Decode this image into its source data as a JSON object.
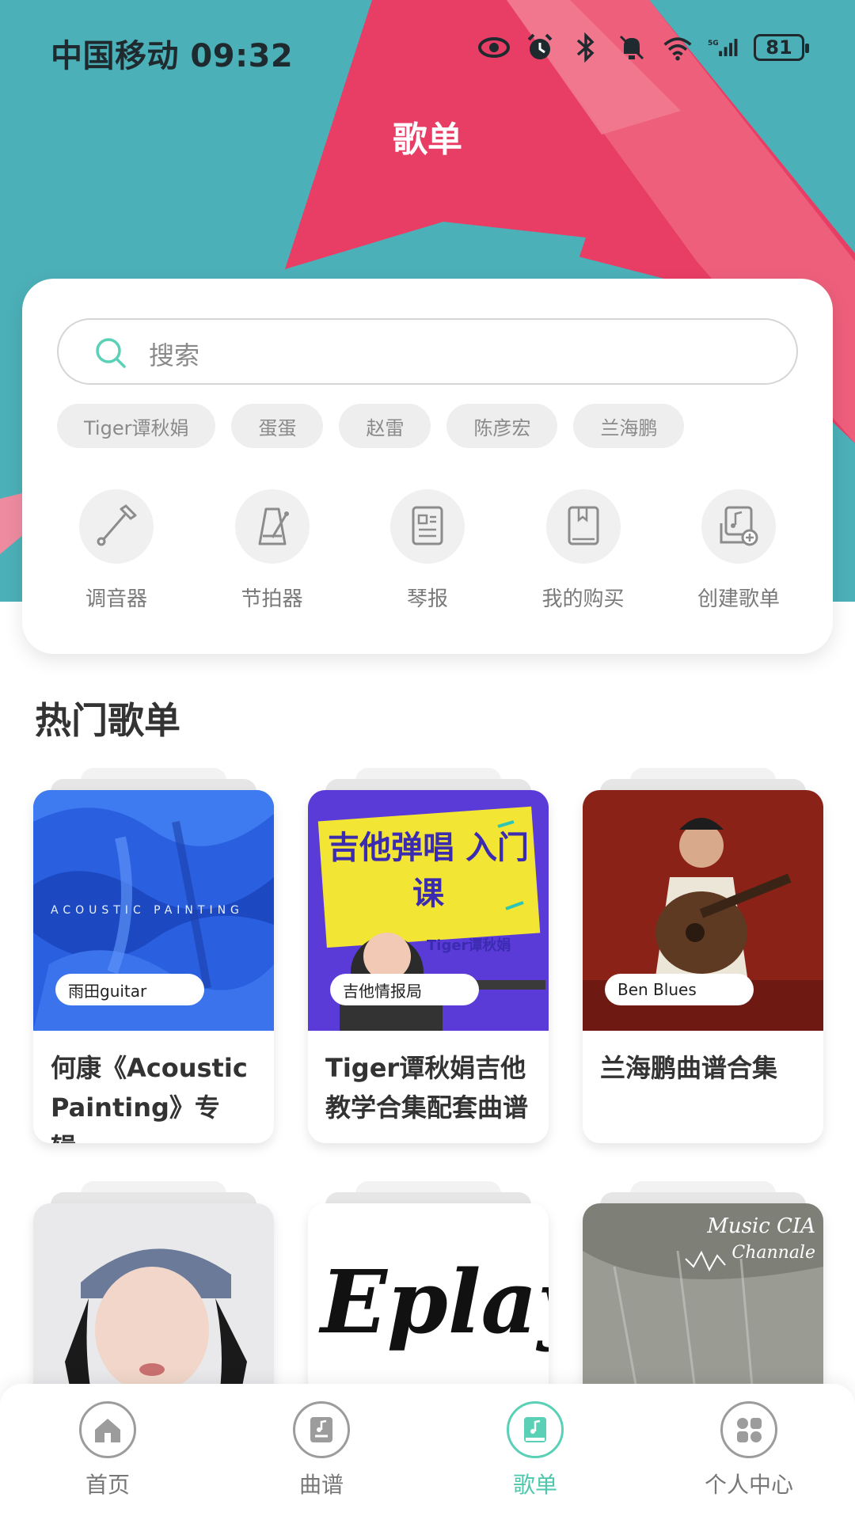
{
  "status_bar": {
    "carrier_time": "中国移动 09:32",
    "battery": "81"
  },
  "page_title": "歌单",
  "search": {
    "placeholder": "搜索"
  },
  "hot_tags": [
    "Tiger谭秋娟",
    "蛋蛋",
    "赵雷",
    "陈彦宏",
    "兰海鹏"
  ],
  "tools": [
    {
      "label": "调音器",
      "icon": "tuning-fork-icon"
    },
    {
      "label": "节拍器",
      "icon": "metronome-icon"
    },
    {
      "label": "琴报",
      "icon": "newspaper-icon"
    },
    {
      "label": "我的购买",
      "icon": "book-icon"
    },
    {
      "label": "创建歌单",
      "icon": "create-playlist-icon"
    }
  ],
  "section_title": "热门歌单",
  "playlists": [
    {
      "badge": "雨田guitar",
      "name": "何康《Acoustic Painting》专辑...",
      "cover_text": "ACOUSTIC PAINTING"
    },
    {
      "badge": "吉他情报局",
      "name": "Tiger谭秋娟吉他教学合集配套曲谱",
      "cover_text": "吉他弹唱 入门课",
      "cover_subtext": "Tiger谭秋娟"
    },
    {
      "badge": "Ben Blues",
      "name": "兰海鹏曲谱合集"
    },
    {
      "badge": "",
      "name": ""
    },
    {
      "badge": "",
      "name": "",
      "cover_text": "Eplay"
    },
    {
      "badge": "",
      "name": "",
      "cover_text": "Music CIA",
      "cover_subtext": "Channale"
    }
  ],
  "bottom_nav": [
    {
      "label": "首页",
      "icon": "home-icon"
    },
    {
      "label": "曲谱",
      "icon": "sheet-music-icon"
    },
    {
      "label": "歌单",
      "icon": "playlist-icon",
      "active": true
    },
    {
      "label": "个人中心",
      "icon": "profile-icon"
    }
  ],
  "colors": {
    "accent": "#4ec7ad",
    "hero_teal": "#4cb0b8",
    "hero_pink": "#e83e65"
  }
}
